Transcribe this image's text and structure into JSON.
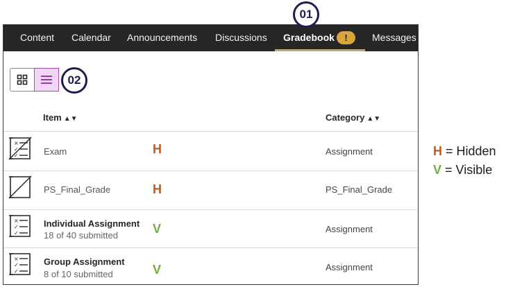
{
  "callouts": {
    "first": "01",
    "second": "02"
  },
  "nav": {
    "items": [
      "Content",
      "Calendar",
      "Announcements",
      "Discussions",
      "Gradebook",
      "Messages"
    ],
    "active": "Gradebook",
    "alert_badge": "!"
  },
  "view_toggle": {
    "active": "list"
  },
  "table": {
    "headers": {
      "item": "Item",
      "category": "Category"
    },
    "rows": [
      {
        "name": "Exam",
        "sub": "",
        "category": "Assignment",
        "mark": "H",
        "icon": "hidden-assessment-icon"
      },
      {
        "name": "PS_Final_Grade",
        "sub": "",
        "category": "PS_Final_Grade",
        "mark": "H",
        "icon": "hidden-calculated-grade-icon"
      },
      {
        "name": "Individual Assignment",
        "sub": "18 of 40 submitted",
        "category": "Assignment",
        "mark": "V",
        "icon": "assessment-icon"
      },
      {
        "name": "Group Assignment",
        "sub": "8 of 10 submitted",
        "category": "Assignment",
        "mark": "V",
        "icon": "assessment-icon"
      }
    ]
  },
  "legend": {
    "hidden_key": "H",
    "hidden_text": "= Hidden",
    "visible_key": "V",
    "visible_text": "= Visible"
  },
  "colors": {
    "hidden": "#c55a11",
    "visible": "#70ad47",
    "toggle_active": "#f1d6f5",
    "nav_bg": "#262626",
    "badge": "#d9a63b"
  }
}
